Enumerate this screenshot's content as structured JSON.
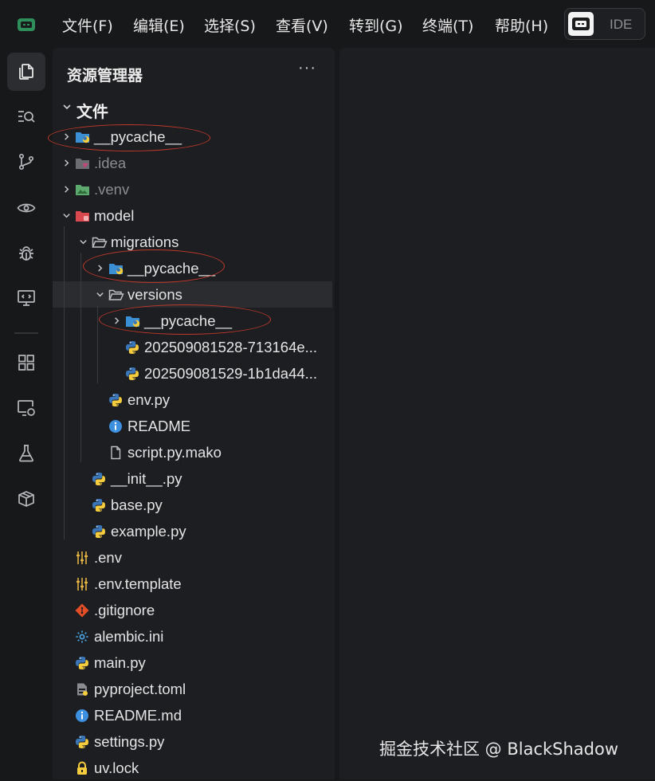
{
  "menu": {
    "items": [
      "文件(F)",
      "编辑(E)",
      "选择(S)",
      "查看(V)",
      "转到(G)",
      "终端(T)",
      "帮助(H)"
    ],
    "ide_label": "IDE"
  },
  "activity_bar": {
    "items": [
      "files-icon",
      "search-icon",
      "source-control-icon",
      "eye-icon",
      "debug-icon",
      "remote-monitor-icon",
      "extensions-icon",
      "remote-explorer-icon",
      "testing-icon",
      "package-icon"
    ],
    "active": "files-icon"
  },
  "explorer": {
    "title": "资源管理器",
    "more": "···",
    "root_label": "文件",
    "rows": [
      {
        "label": "__pycache__",
        "depth": 0,
        "kind": "folder-python",
        "chevron": "closed",
        "dim": false
      },
      {
        "label": ".idea",
        "depth": 0,
        "kind": "folder-idea",
        "chevron": "closed",
        "dim": true
      },
      {
        "label": ".venv",
        "depth": 0,
        "kind": "folder-venv",
        "chevron": "closed",
        "dim": true
      },
      {
        "label": "model",
        "depth": 0,
        "kind": "folder-model",
        "chevron": "open",
        "dim": false
      },
      {
        "label": "migrations",
        "depth": 1,
        "kind": "folder-open",
        "chevron": "open",
        "dim": false
      },
      {
        "label": "__pycache__",
        "depth": 2,
        "kind": "folder-python",
        "chevron": "closed",
        "dim": false
      },
      {
        "label": "versions",
        "depth": 2,
        "kind": "folder-open",
        "chevron": "open",
        "dim": false,
        "selected": true
      },
      {
        "label": "__pycache__",
        "depth": 3,
        "kind": "folder-python",
        "chevron": "closed",
        "dim": false
      },
      {
        "label": "202509081528-713164e...",
        "depth": 3,
        "kind": "python",
        "chevron": "none",
        "dim": false
      },
      {
        "label": "202509081529-1b1da44...",
        "depth": 3,
        "kind": "python",
        "chevron": "none",
        "dim": false
      },
      {
        "label": "env.py",
        "depth": 2,
        "kind": "python",
        "chevron": "none",
        "dim": false
      },
      {
        "label": "README",
        "depth": 2,
        "kind": "info",
        "chevron": "none",
        "dim": false
      },
      {
        "label": "script.py.mako",
        "depth": 2,
        "kind": "file",
        "chevron": "none",
        "dim": false
      },
      {
        "label": "__init__.py",
        "depth": 1,
        "kind": "python",
        "chevron": "none",
        "dim": false
      },
      {
        "label": "base.py",
        "depth": 1,
        "kind": "python",
        "chevron": "none",
        "dim": false
      },
      {
        "label": "example.py",
        "depth": 1,
        "kind": "python",
        "chevron": "none",
        "dim": false
      },
      {
        "label": ".env",
        "depth": 0,
        "kind": "env",
        "chevron": "none",
        "dim": false
      },
      {
        "label": ".env.template",
        "depth": 0,
        "kind": "env",
        "chevron": "none",
        "dim": false
      },
      {
        "label": ".gitignore",
        "depth": 0,
        "kind": "git",
        "chevron": "none",
        "dim": false
      },
      {
        "label": "alembic.ini",
        "depth": 0,
        "kind": "gear",
        "chevron": "none",
        "dim": false
      },
      {
        "label": "main.py",
        "depth": 0,
        "kind": "python",
        "chevron": "none",
        "dim": false
      },
      {
        "label": "pyproject.toml",
        "depth": 0,
        "kind": "toml",
        "chevron": "none",
        "dim": false
      },
      {
        "label": "README.md",
        "depth": 0,
        "kind": "info",
        "chevron": "none",
        "dim": false
      },
      {
        "label": "settings.py",
        "depth": 0,
        "kind": "python",
        "chevron": "none",
        "dim": false
      },
      {
        "label": "uv.lock",
        "depth": 0,
        "kind": "lock",
        "chevron": "none",
        "dim": false
      }
    ]
  },
  "watermark": "掘金技术社区 @ BlackShadow",
  "colors": {
    "background": "#17181a",
    "panel": "#1d1e21",
    "selected_row": "#2b2c2f",
    "annotation": "#c0392b",
    "python_blue": "#3b77b8",
    "python_yellow": "#f5cc3d"
  }
}
